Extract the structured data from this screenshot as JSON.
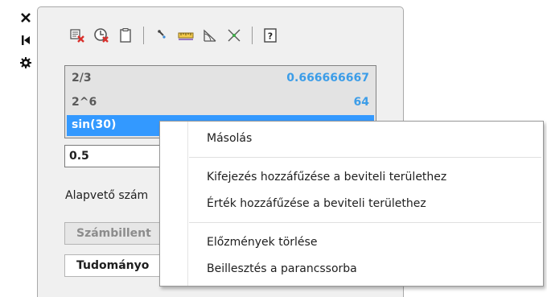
{
  "strip": {
    "icons": [
      "close-icon",
      "pin-icon",
      "settings-icon"
    ]
  },
  "toolbar": {
    "buttons": [
      "clear-history-icon",
      "clear-variable-icon",
      "paste-icon",
      "get-coordinates-icon",
      "measure-distance-icon",
      "measure-angle-icon",
      "intersection-icon",
      "help-icon"
    ],
    "help_label": "?"
  },
  "history": [
    {
      "expr": "2/3",
      "value": "0.666666667"
    },
    {
      "expr": "2^6",
      "value": "64"
    },
    {
      "expr": "sin(30)",
      "value": ""
    }
  ],
  "input": {
    "value": "0.5"
  },
  "mode_label": "Alapvető szám",
  "panels": {
    "number_pad": "Számbillent",
    "scientific": "Tudományo"
  },
  "context_menu": {
    "items": [
      "Másolás",
      "Kifejezés hozzáfűzése a beviteli területhez",
      "Érték hozzáfűzése a beviteli területhez",
      "Előzmények törlése",
      "Beillesztés a parancssorba"
    ]
  },
  "colors": {
    "selection": "#3399ff",
    "value_text": "#3c9de8"
  }
}
